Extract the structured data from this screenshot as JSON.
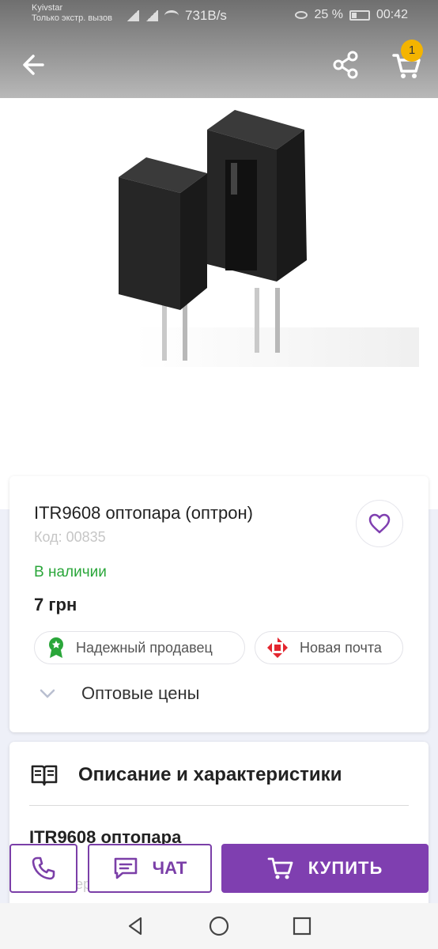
{
  "status_bar": {
    "carrier_line1": "Kyivstar",
    "carrier_line2": "Только экстр. вызов",
    "net_speed": "731B/s",
    "battery_pct": "25 %",
    "time": "00:42"
  },
  "app_bar": {
    "cart_count": "1"
  },
  "product": {
    "title": "ITR9608 оптопара (оптрон)",
    "code": "Код: 00835",
    "availability": "В наличии",
    "price": "7 грн",
    "badges": [
      "Надежный продавец",
      "Новая почта"
    ],
    "wholesale_label": "Оптовые цены"
  },
  "description": {
    "heading": "Описание и характеристики",
    "first_line": "ITR9608 оптопара",
    "faded_line": "Характеристики"
  },
  "actions": {
    "chat_label": "ЧАТ",
    "buy_label": "КУПИТЬ"
  },
  "colors": {
    "accent": "#7f3fb0",
    "in_stock": "#2aa63a",
    "badge": "#f4b400"
  }
}
